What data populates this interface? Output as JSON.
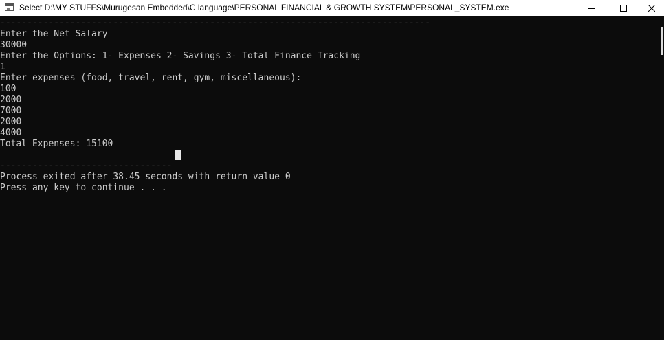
{
  "window": {
    "title": "Select D:\\MY STUFFS\\Murugesan Embedded\\C language\\PERSONAL FINANCIAL & GROWTH SYSTEM\\PERSONAL_SYSTEM.exe",
    "controls": {
      "minimize": "minimize-icon",
      "maximize": "maximize-icon",
      "close": "close-icon"
    }
  },
  "console": {
    "top_rule": "--------------------------------------------------------------------------------",
    "lines": [
      "Enter the Net Salary",
      "30000",
      "Enter the Options: 1- Expenses 2- Savings 3- Total Finance Tracking",
      "1",
      "Enter expenses (food, travel, rent, gym, miscellaneous):",
      "100",
      "2000",
      "7000",
      "2000",
      "4000",
      "Total Expenses: 15100"
    ],
    "bottom_rule": "--------------------------------",
    "exit_message": "Process exited after 38.45 seconds with return value 0",
    "continue_prompt": "Press any key to continue . . ."
  },
  "colors": {
    "console_background": "#0c0c0c",
    "console_text": "#cccccc",
    "titlebar_background": "#ffffff"
  }
}
